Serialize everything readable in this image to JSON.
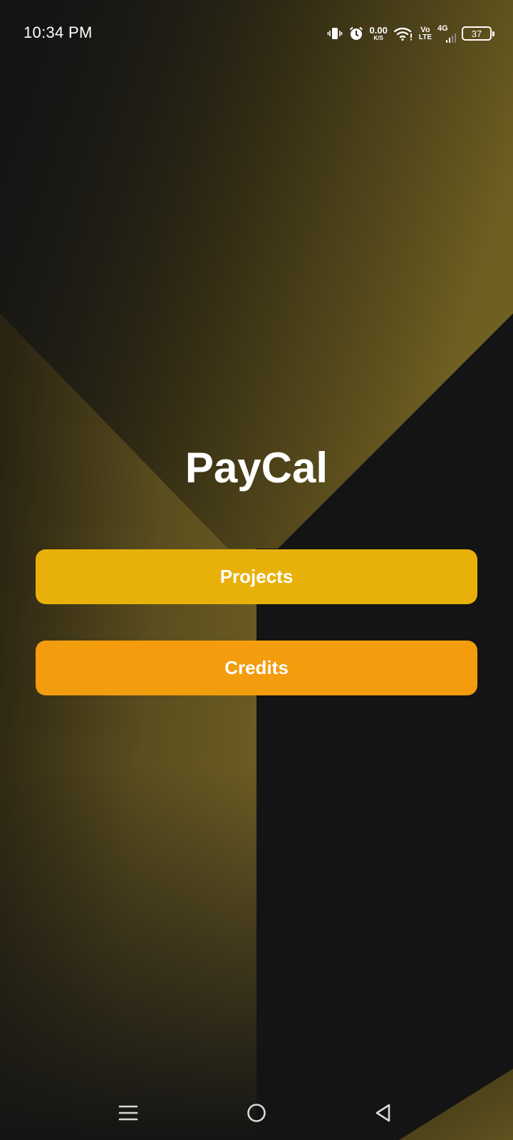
{
  "status_bar": {
    "time": "10:34 PM",
    "net_speed_value": "0.00",
    "net_speed_unit": "K/S",
    "volte_top": "Vo",
    "volte_bottom": "LTE",
    "network_type": "4G",
    "battery_level": "37",
    "icons": [
      "vibrate-icon",
      "alarm-icon",
      "wifi-icon",
      "signal-icon",
      "battery-icon"
    ]
  },
  "main": {
    "app_title": "PayCal",
    "projects_button": {
      "label": "Projects",
      "color": "#e8b10a"
    },
    "credits_button": {
      "label": "Credits",
      "color": "#f29c0e"
    }
  },
  "nav_bar": {
    "icons": [
      "menu-icon",
      "home-icon",
      "back-icon"
    ]
  },
  "theme": {
    "background": "#141414",
    "accent_gold": "#6b5a1e"
  }
}
